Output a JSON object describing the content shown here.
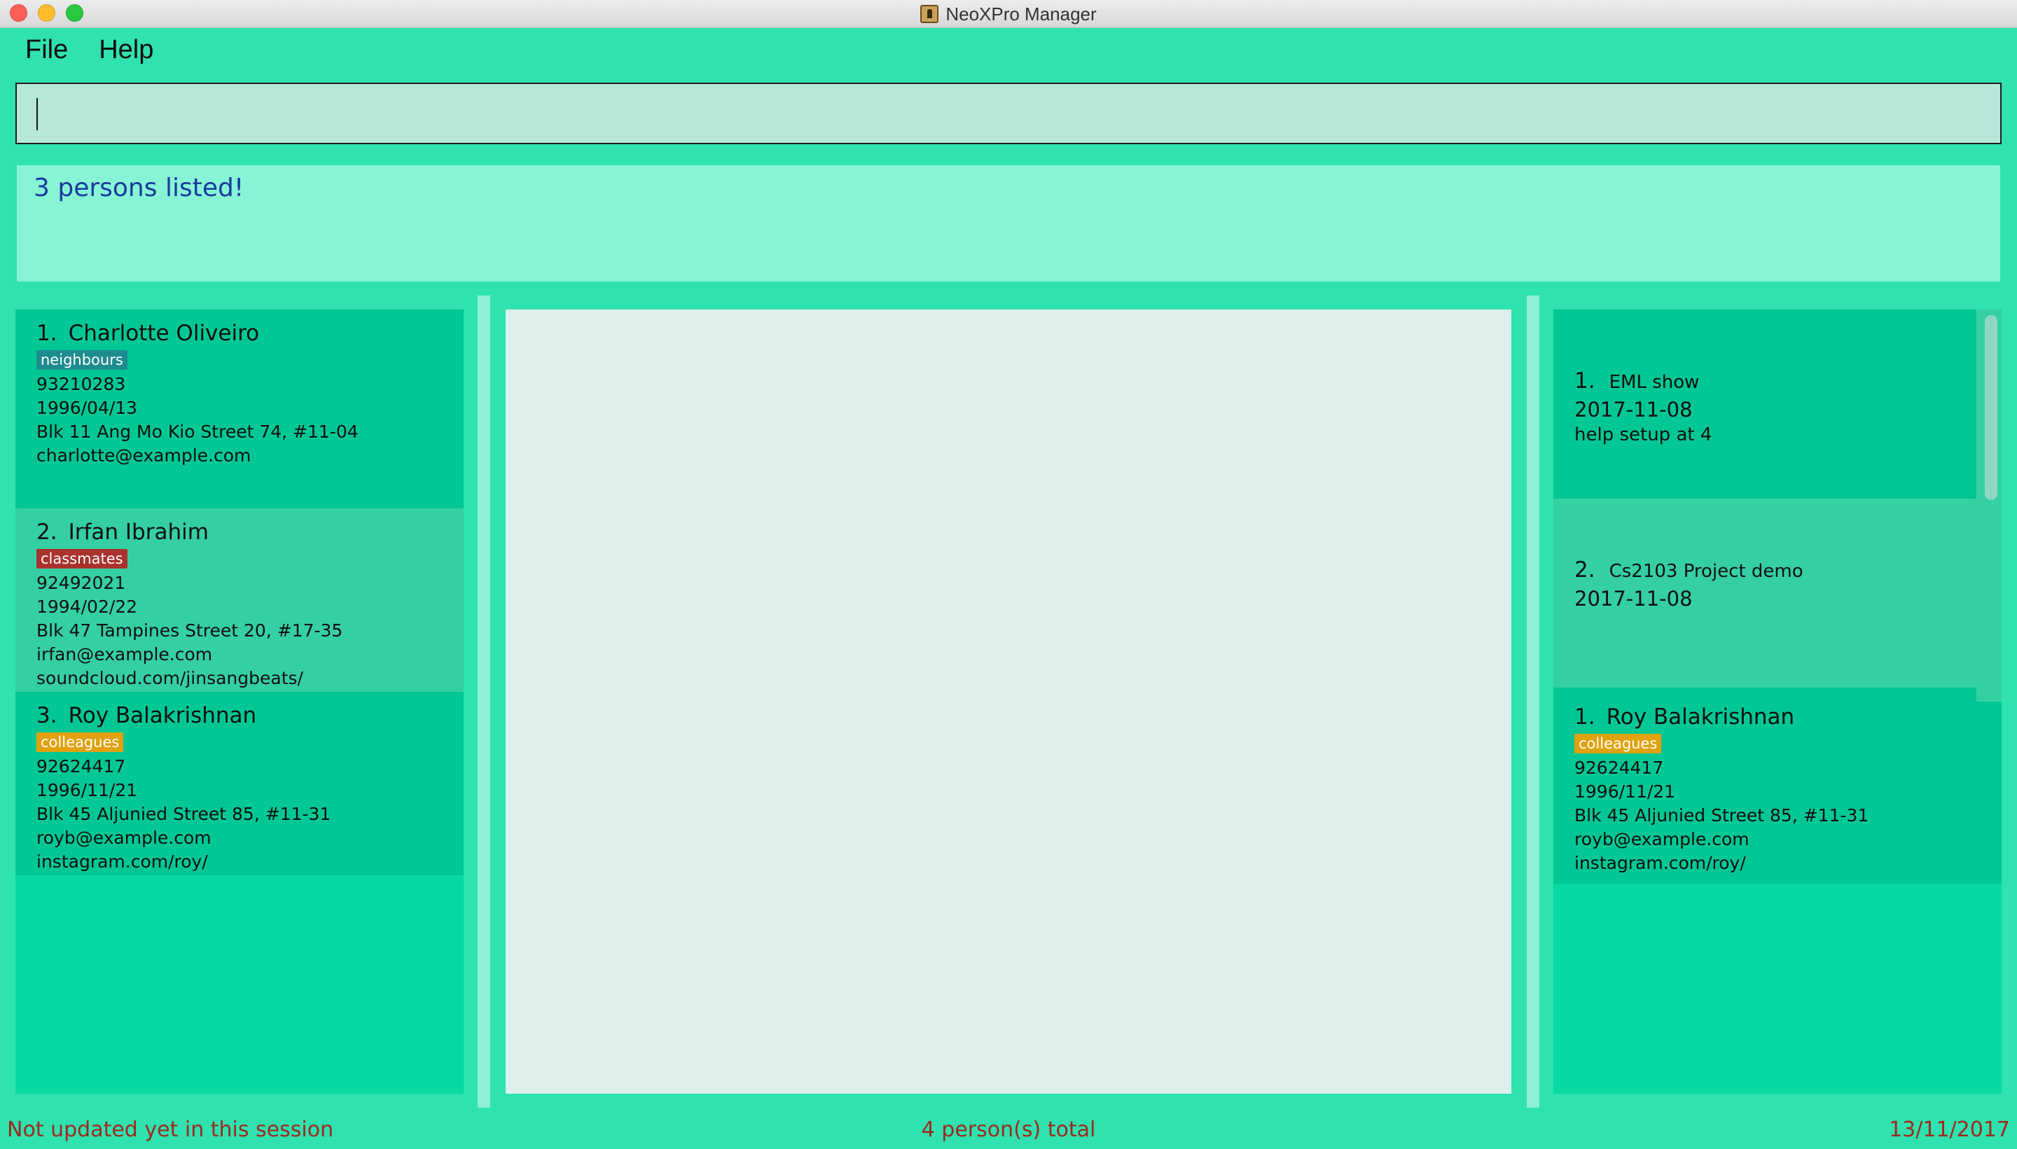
{
  "window": {
    "title": "NeoXPro Manager",
    "app_icon": "address-book-icon"
  },
  "menu": {
    "file": "File",
    "help": "Help"
  },
  "command": {
    "value": "",
    "placeholder": ""
  },
  "result": {
    "message": "3 persons listed!"
  },
  "persons": [
    {
      "index": "1.",
      "name": "Charlotte Oliveiro",
      "tag": "neighbours",
      "tag_color": "#1d8c8f",
      "phone": "93210283",
      "birthday": "1996/04/13",
      "address": "Blk 11 Ang Mo Kio Street 74, #11-04",
      "email": "charlotte@example.com",
      "website": ""
    },
    {
      "index": "2.",
      "name": "Irfan Ibrahim",
      "tag": "classmates",
      "tag_color": "#a8322c",
      "phone": "92492021",
      "birthday": "1994/02/22",
      "address": "Blk 47 Tampines Street 20, #17-35",
      "email": "irfan@example.com",
      "website": "soundcloud.com/jinsangbeats/"
    },
    {
      "index": "3.",
      "name": "Roy Balakrishnan",
      "tag": "colleagues",
      "tag_color": "#e0a10c",
      "phone": "92624417",
      "birthday": "1996/11/21",
      "address": "Blk 45 Aljunied Street 85, #11-31",
      "email": "royb@example.com",
      "website": "instagram.com/roy/"
    }
  ],
  "events": [
    {
      "index": "1.",
      "title": "EML show",
      "date": "2017-11-08",
      "description": "help setup at 4"
    },
    {
      "index": "2.",
      "title": "Cs2103 Project demo",
      "date": "2017-11-08",
      "description": ""
    }
  ],
  "selected_person": {
    "index": "1.",
    "name": "Roy Balakrishnan",
    "tag": "colleagues",
    "tag_color": "#e0a10c",
    "phone": "92624417",
    "birthday": "1996/11/21",
    "address": "Blk 45 Aljunied Street 85, #11-31",
    "email": "royb@example.com",
    "website": "instagram.com/roy/"
  },
  "status": {
    "sync": "Not updated yet in this session",
    "total": "4 person(s) total",
    "date": "13/11/2017"
  },
  "colors": {
    "background": "#2fe2b0",
    "card_dark": "#00c793",
    "card_light": "#35cfa4",
    "status_text": "#9c2a1e",
    "result_text": "#1a3a9c"
  }
}
